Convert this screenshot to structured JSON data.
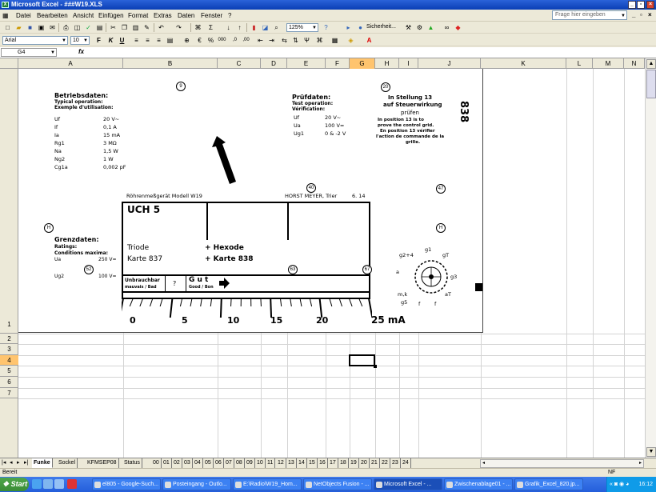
{
  "window": {
    "title": "Microsoft Excel - ###W19.XLS",
    "icon": "excel-icon"
  },
  "menu": [
    "Datei",
    "Bearbeiten",
    "Ansicht",
    "Einfügen",
    "Format",
    "Extras",
    "Daten",
    "Fenster",
    "?"
  ],
  "help_placeholder": "Frage hier eingeben",
  "toolbar": {
    "zoom": "125%",
    "security": "Sicherheit...",
    "font": "Arial",
    "size": "10"
  },
  "namebox": "G4",
  "fx_label": "fx",
  "columns": [
    "A",
    "B",
    "C",
    "D",
    "E",
    "F",
    "G",
    "H",
    "I",
    "J",
    "K",
    "L",
    "M",
    "N"
  ],
  "rows": [
    "1",
    "2",
    "3",
    "4",
    "5",
    "6",
    "7"
  ],
  "drawing": {
    "betrieb": {
      "title": "Betriebsdaten:",
      "sub1": "Typical operation:",
      "sub2": "Exemple d'utilisation:",
      "params": [
        {
          "k": "Uf",
          "v": "20 V~"
        },
        {
          "k": "If",
          "v": "0,1 A"
        },
        {
          "k": "Ia",
          "v": "15 mA"
        },
        {
          "k": "Rg1",
          "v": "3 MΩ"
        },
        {
          "k": "Na",
          "v": "1,5 W"
        },
        {
          "k": "Ng2",
          "v": "1 W"
        },
        {
          "k": "Cg1a",
          "v": "0,002 pF"
        }
      ]
    },
    "pruef": {
      "title": "Prüfdaten:",
      "sub1": "Test operation:",
      "sub2": "Vérification:",
      "params": [
        {
          "k": "Uf",
          "v": "20 V~"
        },
        {
          "k": "Ua",
          "v": "100 V="
        },
        {
          "k": "Ug1",
          "v": "0 & -2 V"
        }
      ]
    },
    "stellung": {
      "l1": "In Stellung 13",
      "l2": "auf Steuerwirkung",
      "l3": "prüfen",
      "l4": "In position 13 is to",
      "l5": "prove the control grid.",
      "l6": "En position 13 vérifier",
      "l7": "l'action de commande de la",
      "l8": "grille."
    },
    "side_number": "838",
    "grenz": {
      "title": "Grenzdaten:",
      "sub1": "Ratings:",
      "sub2": "Conditions maxima:",
      "p1k": "Ua",
      "p1v": "250 V=",
      "p2k": "Ug2",
      "p2v": "100 V="
    },
    "circles": {
      "c9": "9",
      "c20": "20",
      "c40": "40",
      "c47": "47",
      "cH1": "H",
      "cH2": "H",
      "c52": "52",
      "c63": "63",
      "c67": "67"
    },
    "header_left": "Röhrenmeßgerät Modell W19",
    "header_right": "HORST MEYER, Trier",
    "header_date": "6. 14",
    "tube": "UCH 5",
    "triode": "Triode",
    "karte_left": "Karte 837",
    "hexode": "+ Hexode",
    "karte_right": "+ Karte 838",
    "unbrauchbar": "Unbrauchbar",
    "mauvais": "mauvais / Bad",
    "question": "?",
    "gut": "G u t",
    "good": "Good / Bon",
    "scale": [
      "0",
      "5",
      "10",
      "15",
      "20",
      "25 mA"
    ],
    "pins": {
      "p1": "g2+4",
      "p2": "g1",
      "p3": "gT",
      "p4": "a",
      "p5": "g3",
      "p6": "m,k",
      "p7": "g5",
      "p8": "f",
      "p9": "f",
      "p10": "aT"
    }
  },
  "sheets": [
    "Funke",
    "Sockel",
    "KFMSEP08",
    "Status",
    "00",
    "01",
    "02",
    "03",
    "04",
    "05",
    "06",
    "07",
    "08",
    "09",
    "10",
    "11",
    "12",
    "13",
    "14",
    "15",
    "16",
    "17",
    "18",
    "19",
    "20",
    "21",
    "22",
    "23",
    "24"
  ],
  "status": {
    "left": "Bereit",
    "right": "NF"
  },
  "taskbar": {
    "start": "Start",
    "tasks": [
      "el805 - Google-Such...",
      "Posteingang - Outlo...",
      "E:\\Radio\\W19_Hom...",
      "NetObjects Fusion - ...",
      "Microsoft Excel - ...",
      "Zwischenablage01 - ...",
      "Grafik_Excel_820.jp..."
    ],
    "clock": "16:12"
  }
}
